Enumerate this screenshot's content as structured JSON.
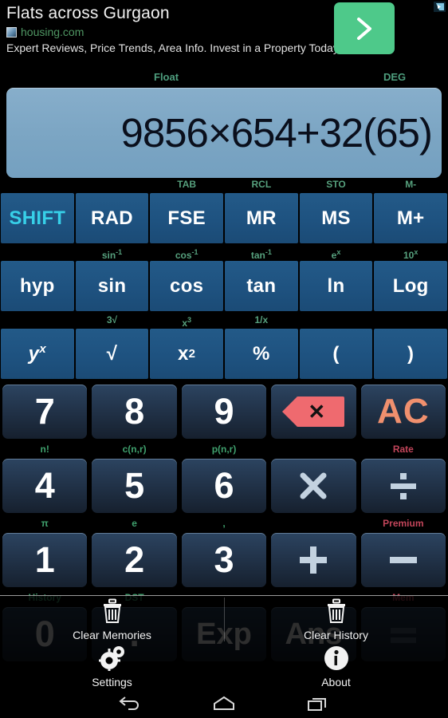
{
  "ad": {
    "title": "Flats across Gurgaon",
    "source": "housing.com",
    "description": "Expert Reviews, Price Trends, Area Info. Invest in a Property Today!",
    "cta_icon": "chevron-right-icon",
    "adchoices_icon": "adchoices-icon",
    "cta_color": "#4ec98a"
  },
  "status": {
    "float_mode": "Float",
    "angle_mode": "DEG",
    "indicator_color": "#4e9e7e"
  },
  "display": {
    "expression": "9856×654+32(65)",
    "background": "#7ba5c3",
    "text_color": "#0a0f1c"
  },
  "keypad": {
    "function_rows": [
      {
        "keys": [
          {
            "label": "SHIFT",
            "sub": "",
            "accent": "#37d0e8"
          },
          {
            "label": "RAD",
            "sub": ""
          },
          {
            "label": "FSE",
            "sub": "TAB"
          },
          {
            "label": "MR",
            "sub": "RCL"
          },
          {
            "label": "MS",
            "sub": "STO"
          },
          {
            "label": "M+",
            "sub": "M-"
          }
        ]
      },
      {
        "keys": [
          {
            "label": "hyp",
            "sub": ""
          },
          {
            "label": "sin",
            "sub": "sin",
            "sub_sup": "-1"
          },
          {
            "label": "cos",
            "sub": "cos",
            "sub_sup": "-1"
          },
          {
            "label": "tan",
            "sub": "tan",
            "sub_sup": "-1"
          },
          {
            "label": "ln",
            "sub": "e",
            "sub_sup": "x"
          },
          {
            "label": "Log",
            "sub": "10",
            "sub_sup": "x"
          }
        ]
      },
      {
        "keys": [
          {
            "label": "y",
            "label_sup": "x",
            "sub": ""
          },
          {
            "label": "√",
            "sub": "3√"
          },
          {
            "label": "x",
            "label_sup": "2",
            "sub": "x",
            "sub_sup": "3"
          },
          {
            "label": "%",
            "sub": "1/x"
          },
          {
            "label": "(",
            "sub": ""
          },
          {
            "label": ")",
            "sub": ""
          }
        ]
      }
    ],
    "numeric_rows": [
      {
        "keys": [
          {
            "label": "7",
            "sub": "n!"
          },
          {
            "label": "8",
            "sub": "c(n,r)"
          },
          {
            "label": "9",
            "sub": "p(n,r)"
          },
          {
            "label": "",
            "icon": "backspace-icon",
            "sub": ""
          },
          {
            "label": "AC",
            "sub": "Rate",
            "sub_color": "#c2455a",
            "accent": "#f0906e"
          }
        ]
      },
      {
        "keys": [
          {
            "label": "4",
            "sub": "π"
          },
          {
            "label": "5",
            "sub": "e"
          },
          {
            "label": "6",
            "sub": ","
          },
          {
            "label": "",
            "icon": "multiply-icon",
            "sub": ""
          },
          {
            "label": "",
            "icon": "divide-icon",
            "sub": "Premium",
            "sub_color": "#c2455a"
          }
        ]
      },
      {
        "keys": [
          {
            "label": "1",
            "sub": "History"
          },
          {
            "label": "2",
            "sub": "DST"
          },
          {
            "label": "3",
            "sub": ""
          },
          {
            "label": "",
            "icon": "plus-icon",
            "sub": ""
          },
          {
            "label": "",
            "icon": "minus-icon",
            "sub": "Mem",
            "sub_color": "#c2455a"
          }
        ]
      },
      {
        "keys": [
          {
            "label": "0",
            "sub": ""
          },
          {
            "label": ".",
            "sub": ""
          },
          {
            "label": "Exp",
            "sub": ""
          },
          {
            "label": "Ans",
            "sub": ""
          },
          {
            "label": "",
            "icon": "equals-icon",
            "sub": ""
          }
        ]
      }
    ]
  },
  "overlay_menu": {
    "items": [
      {
        "label": "Clear Memories",
        "icon": "trash-icon"
      },
      {
        "label": "Clear History",
        "icon": "trash-icon"
      },
      {
        "label": "Settings",
        "icon": "gear-icon"
      },
      {
        "label": "About",
        "icon": "info-icon"
      }
    ]
  },
  "navbar": {
    "back": "back-icon",
    "home": "home-icon",
    "recents": "recents-icon"
  }
}
